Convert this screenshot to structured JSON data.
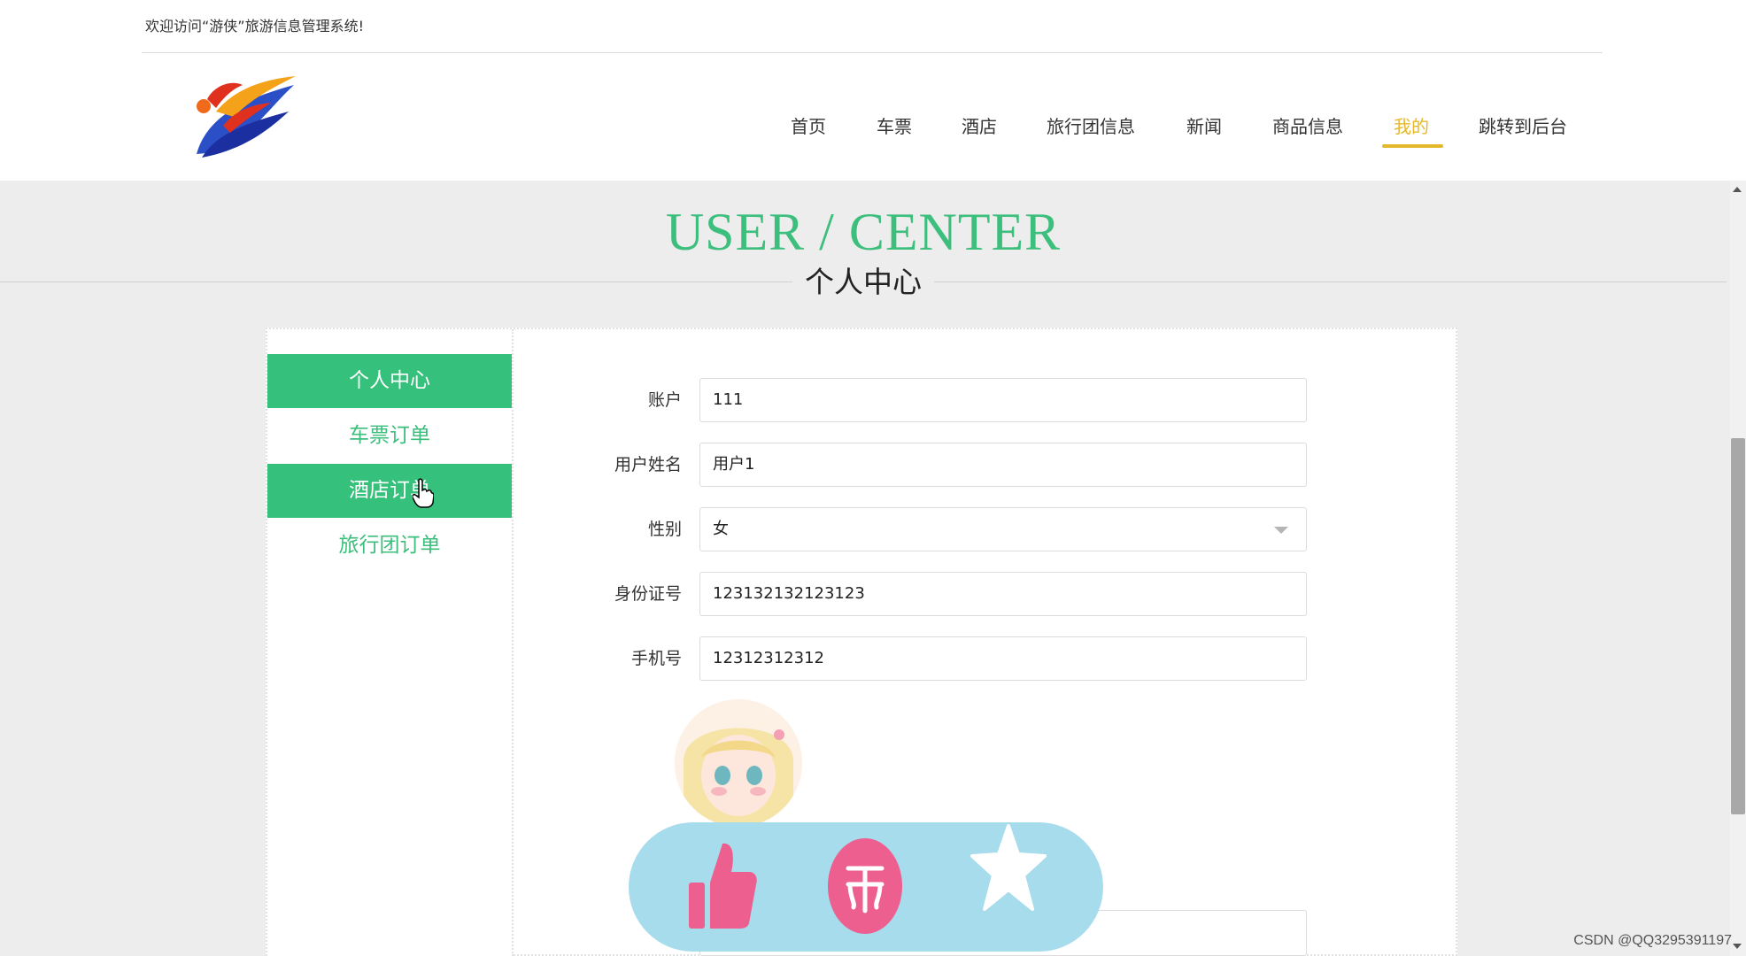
{
  "header": {
    "welcome": "欢迎访问“游侠”旅游信息管理系统!",
    "logo": "logo-icon"
  },
  "nav": {
    "items": [
      {
        "label": "首页"
      },
      {
        "label": "车票"
      },
      {
        "label": "酒店"
      },
      {
        "label": "旅行团信息"
      },
      {
        "label": "新闻"
      },
      {
        "label": "商品信息"
      },
      {
        "label": "我的"
      },
      {
        "label": "跳转到后台"
      }
    ],
    "active_index": 6,
    "active_color": "#e5b82c"
  },
  "hero": {
    "title_en": "USER / CENTER",
    "title_cn": "个人中心",
    "accent_color": "#3cbe7c"
  },
  "sidebar": {
    "items": [
      {
        "label": "个人中心",
        "active": true
      },
      {
        "label": "车票订单",
        "active": false
      },
      {
        "label": "酒店订单",
        "active": true
      },
      {
        "label": "旅行团订单",
        "active": false
      }
    ],
    "active_color": "#35c07b"
  },
  "form": {
    "fields": [
      {
        "label": "账户",
        "value": "111"
      },
      {
        "label": "用户姓名",
        "value": "用户1"
      },
      {
        "label": "性别",
        "value": "女"
      },
      {
        "label": "身份证号",
        "value": "123132132123123"
      },
      {
        "label": "手机号",
        "value": "12312312312"
      }
    ]
  },
  "avatar": "avatar-image",
  "fab": {
    "icons": [
      "thumbs-up-icon",
      "coin-icon",
      "star-icon"
    ],
    "background": "#a6dcec"
  },
  "watermark": "CSDN @QQ3295391197"
}
